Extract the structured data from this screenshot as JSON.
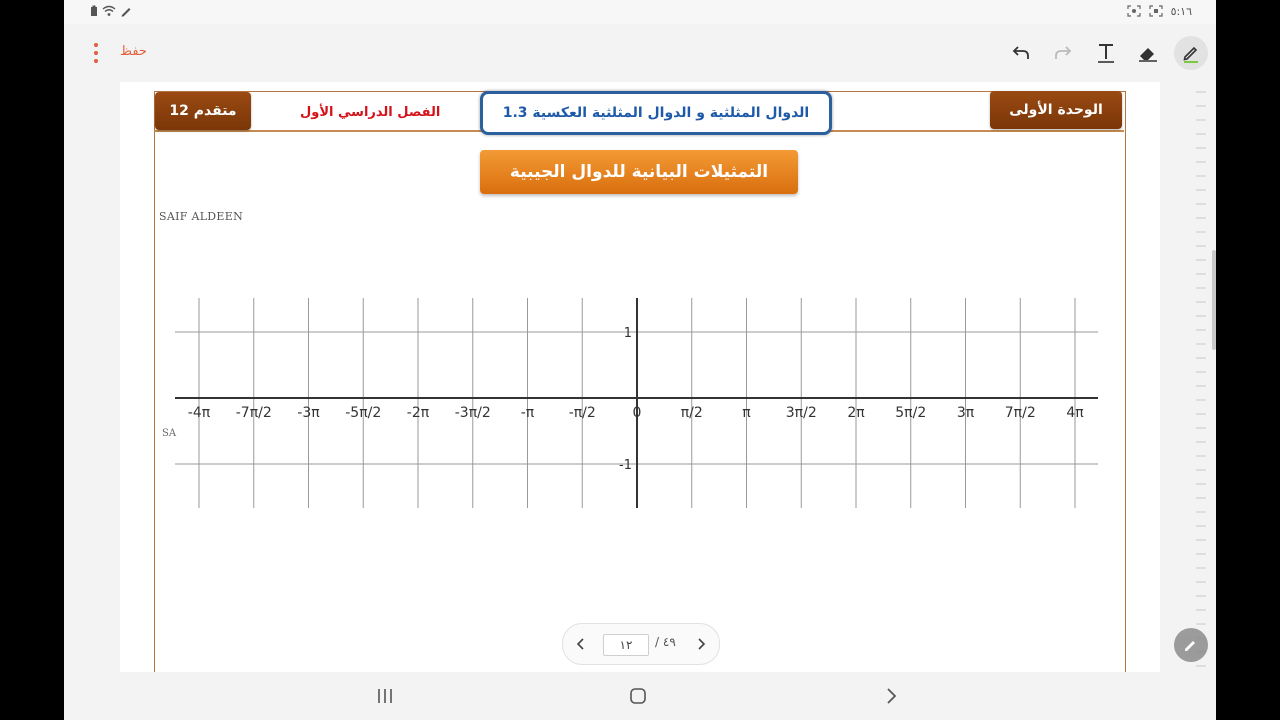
{
  "status_bar": {
    "time": "٥:١٦",
    "left_icons": [
      "battery-icon",
      "wifi-icon",
      "pen-signal-icon"
    ],
    "right_icons": [
      "screenshot-icon",
      "screen-record-icon"
    ]
  },
  "toolbar": {
    "save_label": "حفظ",
    "tools": [
      "undo-icon",
      "redo-icon",
      "text-tool-icon",
      "eraser-icon",
      "pen-icon"
    ],
    "active_tool": "pen-icon"
  },
  "document": {
    "grade_tab": "12 متقدم",
    "semester": "الفصل الدراسي الأول",
    "lesson_title": "الدوال المثلثية و الدوال المثلثية العكسية 1.3",
    "unit_tab": "الوحدة الأولى",
    "banner_title": "التمثيلات البيانية للدوال الجيبية",
    "author": "SAIF ALDEEN",
    "author_clipped": "SA"
  },
  "chart_data": {
    "type": "line",
    "title": "",
    "xlabel": "",
    "ylabel": "",
    "series": [],
    "x_ticks": [
      "-4π",
      "-7π/2",
      "-3π",
      "-5π/2",
      "-2π",
      "-3π/2",
      "-π",
      "-π/2",
      "0",
      "π/2",
      "π",
      "3π/2",
      "2π",
      "5π/2",
      "3π",
      "7π/2",
      "4π"
    ],
    "y_ticks": [
      "1",
      "-1"
    ],
    "xlim": [
      -8,
      8
    ],
    "ylim": [
      -1.5,
      1.5
    ],
    "grid": true,
    "legend": "none"
  },
  "pager": {
    "current_page": "١٢",
    "total_pages": "٤٩",
    "separator": "/"
  },
  "colors": {
    "accent_orange": "#e2603a",
    "brown_tab": "#8a3f0d",
    "lesson_blue": "#1f5aa8",
    "semester_red": "#d4121a",
    "banner_orange": "#e8831f"
  }
}
